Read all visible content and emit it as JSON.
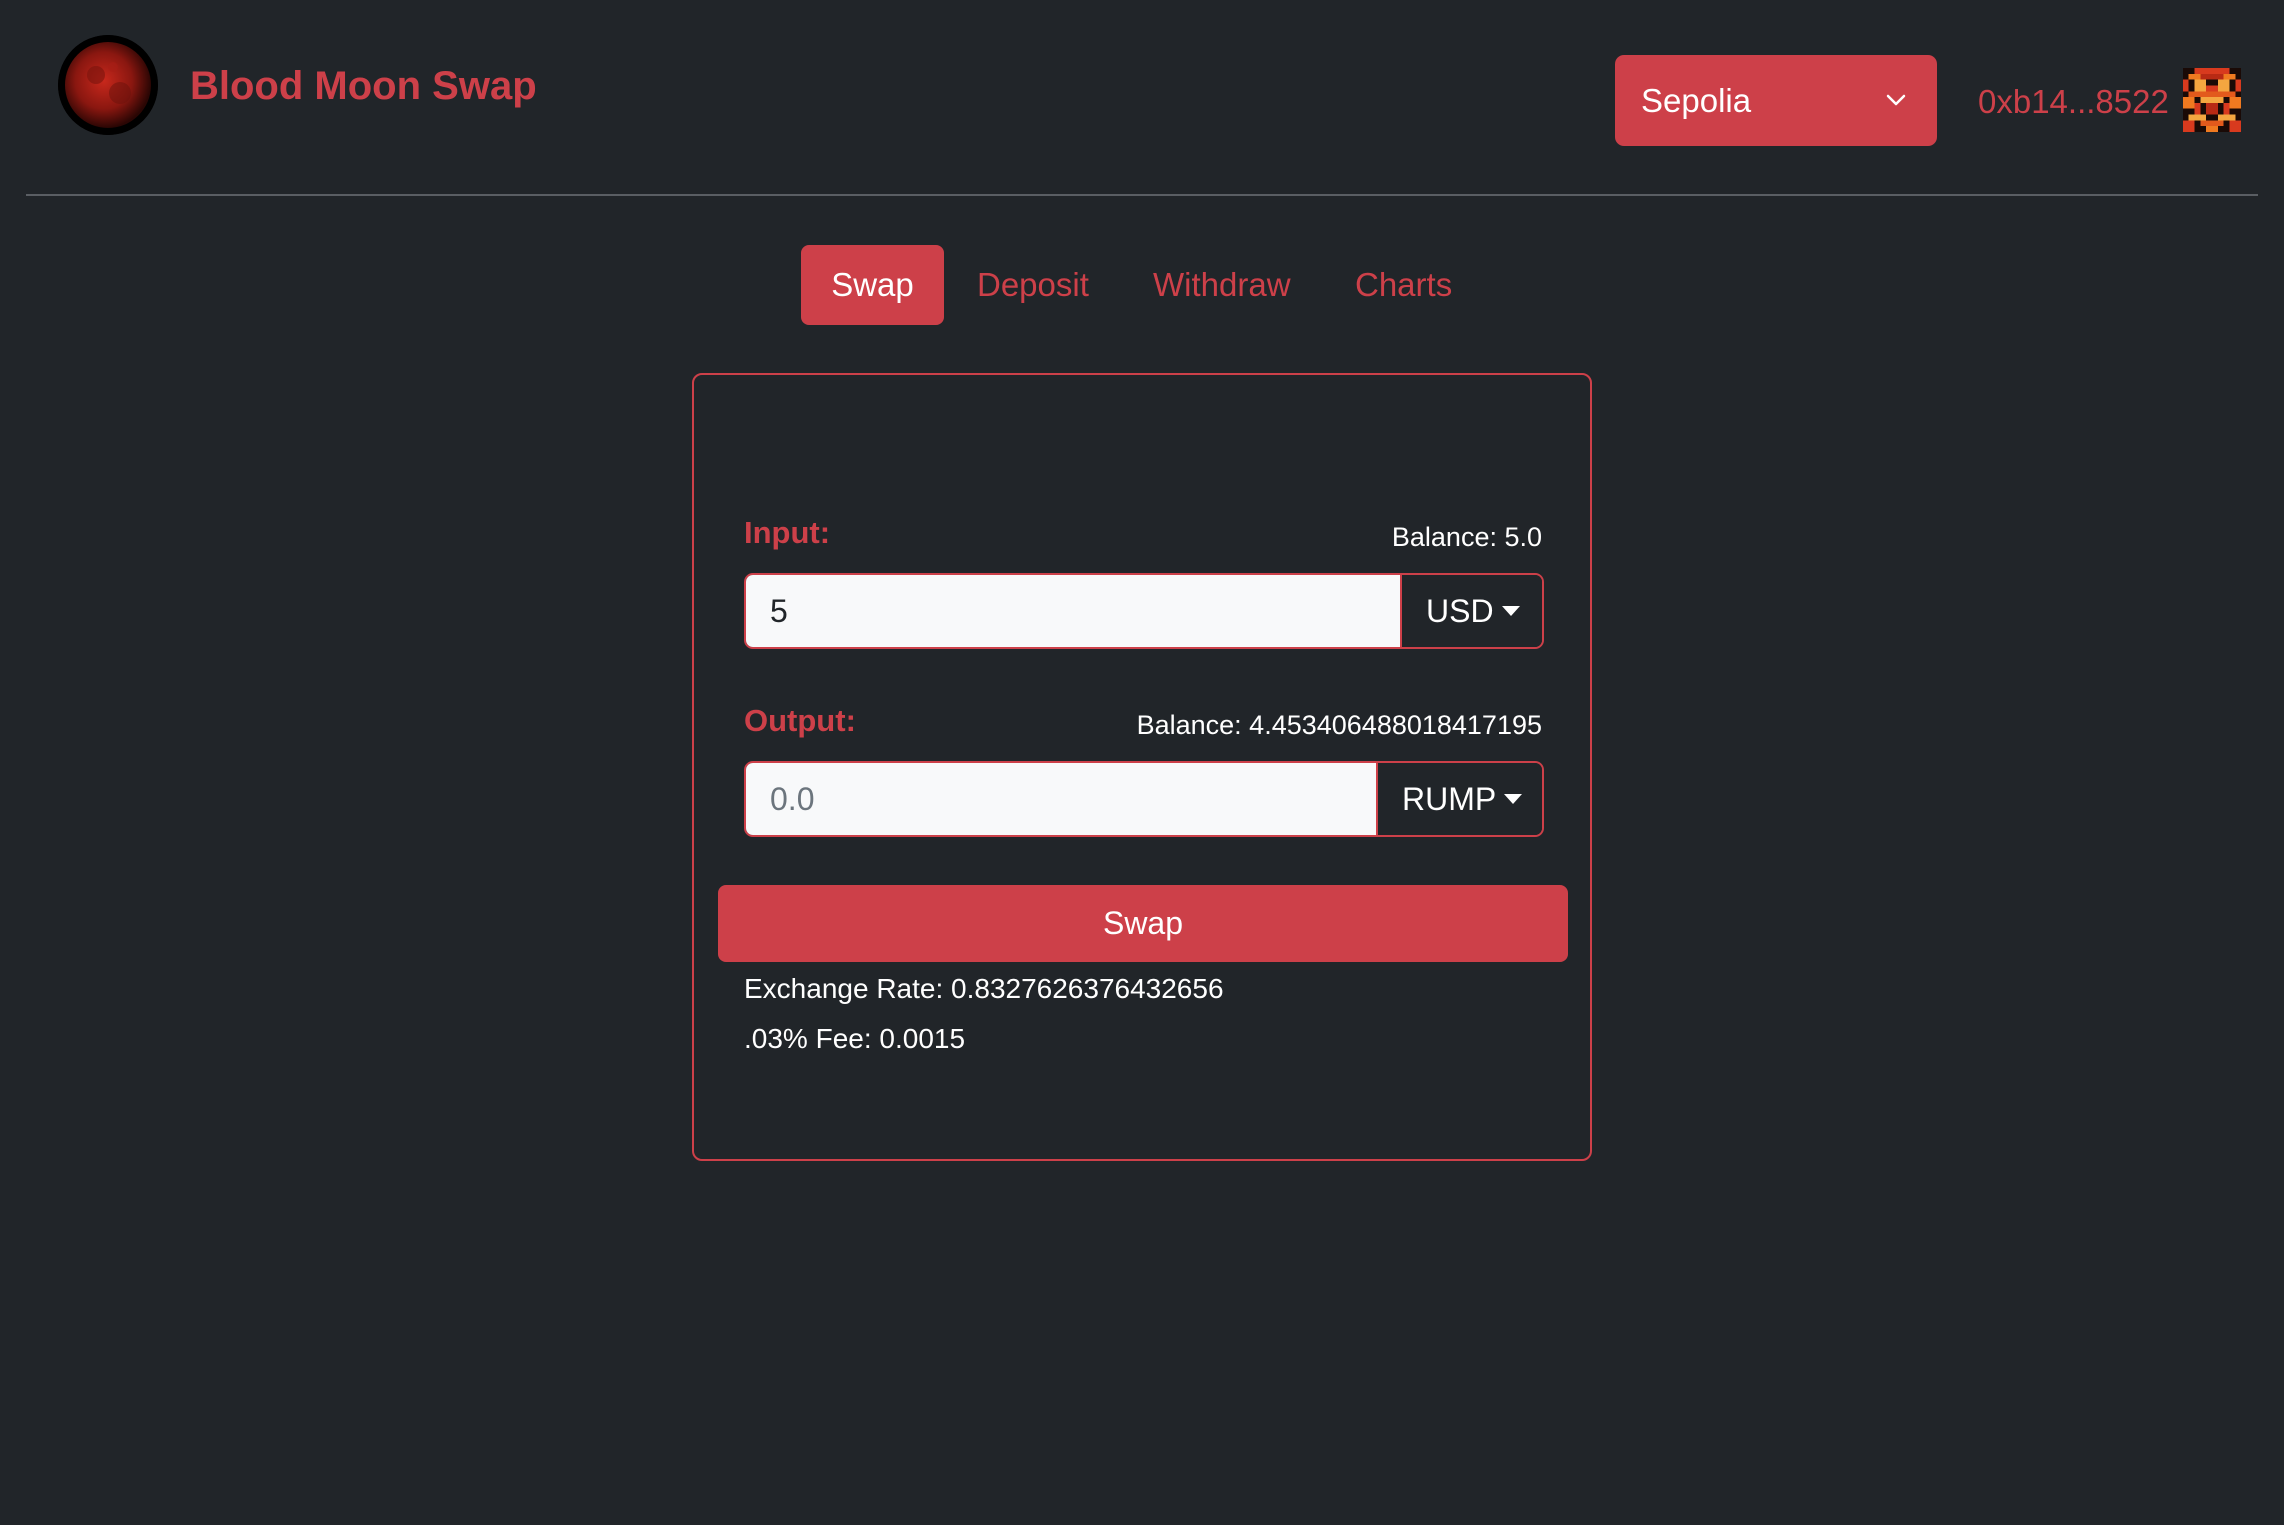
{
  "header": {
    "brand": "Blood Moon Swap",
    "network": "Sepolia",
    "account": "0xb14...8522"
  },
  "tabs": [
    {
      "label": "Swap",
      "active": true
    },
    {
      "label": "Deposit",
      "active": false
    },
    {
      "label": "Withdraw",
      "active": false
    },
    {
      "label": "Charts",
      "active": false
    }
  ],
  "swap": {
    "input_label": "Input:",
    "input_balance": "Balance: 5.0",
    "input_value": "5",
    "input_token": "USD",
    "output_label": "Output:",
    "output_balance": "Balance: 4.453406488018417195",
    "output_placeholder": "0.0",
    "output_token": "RUMP",
    "button_label": "Swap",
    "exchange_rate": "Exchange Rate: 0.8327626376432656",
    "fee": ".03% Fee: 0.0015"
  },
  "colors": {
    "accent": "#cd4049",
    "background": "#212529"
  },
  "icons": {
    "logo": "blood-moon-logo",
    "network_chevron": "chevron-down-icon",
    "avatar": "identicon"
  }
}
